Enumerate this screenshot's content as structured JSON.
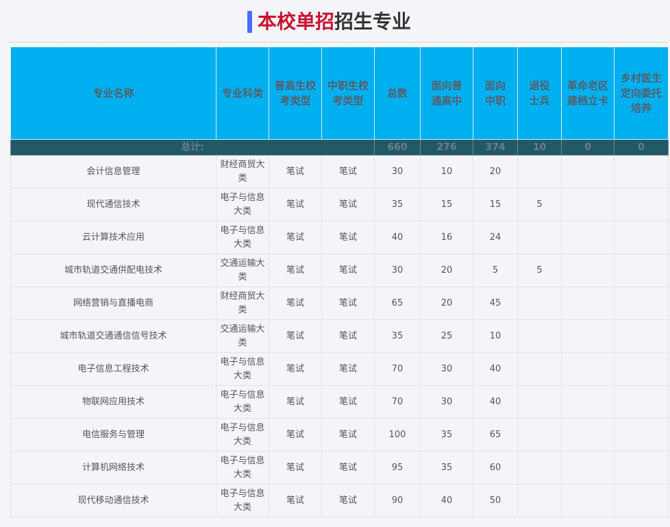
{
  "title": {
    "highlight": "本校单招",
    "rest": "招生专业"
  },
  "columns": [
    "专业名称",
    "专业科类",
    "普高生校考类型",
    "中职生校考类型",
    "总数",
    "面向普通高中",
    "面向中职",
    "退役士兵",
    "革命老区建档立卡",
    "乡村医生定向委托培养"
  ],
  "total": {
    "label": "总计:",
    "values": [
      "660",
      "276",
      "374",
      "10",
      "0",
      "0"
    ]
  },
  "rows": [
    {
      "name": "会计信息管理",
      "category": "财经商贸大类",
      "pugao": "笔试",
      "zhongzhi": "笔试",
      "total": "30",
      "gaozhong": "10",
      "zhongzhi_n": "20",
      "veteran": "",
      "laoqu": "",
      "doctor": ""
    },
    {
      "name": "现代通信技术",
      "category": "电子与信息大类",
      "pugao": "笔试",
      "zhongzhi": "笔试",
      "total": "35",
      "gaozhong": "15",
      "zhongzhi_n": "15",
      "veteran": "5",
      "laoqu": "",
      "doctor": ""
    },
    {
      "name": "云计算技术应用",
      "category": "电子与信息大类",
      "pugao": "笔试",
      "zhongzhi": "笔试",
      "total": "40",
      "gaozhong": "16",
      "zhongzhi_n": "24",
      "veteran": "",
      "laoqu": "",
      "doctor": ""
    },
    {
      "name": "城市轨道交通供配电技术",
      "category": "交通运输大类",
      "pugao": "笔试",
      "zhongzhi": "笔试",
      "total": "30",
      "gaozhong": "20",
      "zhongzhi_n": "5",
      "veteran": "5",
      "laoqu": "",
      "doctor": ""
    },
    {
      "name": "网络营销与直播电商",
      "category": "财经商贸大类",
      "pugao": "笔试",
      "zhongzhi": "笔试",
      "total": "65",
      "gaozhong": "20",
      "zhongzhi_n": "45",
      "veteran": "",
      "laoqu": "",
      "doctor": ""
    },
    {
      "name": "城市轨道交通通信信号技术",
      "category": "交通运输大类",
      "pugao": "笔试",
      "zhongzhi": "笔试",
      "total": "35",
      "gaozhong": "25",
      "zhongzhi_n": "10",
      "veteran": "",
      "laoqu": "",
      "doctor": ""
    },
    {
      "name": "电子信息工程技术",
      "category": "电子与信息大类",
      "pugao": "笔试",
      "zhongzhi": "笔试",
      "total": "70",
      "gaozhong": "30",
      "zhongzhi_n": "40",
      "veteran": "",
      "laoqu": "",
      "doctor": ""
    },
    {
      "name": "物联网应用技术",
      "category": "电子与信息大类",
      "pugao": "笔试",
      "zhongzhi": "笔试",
      "total": "70",
      "gaozhong": "30",
      "zhongzhi_n": "40",
      "veteran": "",
      "laoqu": "",
      "doctor": ""
    },
    {
      "name": "电信服务与管理",
      "category": "电子与信息大类",
      "pugao": "笔试",
      "zhongzhi": "笔试",
      "total": "100",
      "gaozhong": "35",
      "zhongzhi_n": "65",
      "veteran": "",
      "laoqu": "",
      "doctor": ""
    },
    {
      "name": "计算机网络技术",
      "category": "电子与信息大类",
      "pugao": "笔试",
      "zhongzhi": "笔试",
      "total": "95",
      "gaozhong": "35",
      "zhongzhi_n": "60",
      "veteran": "",
      "laoqu": "",
      "doctor": ""
    },
    {
      "name": "现代移动通信技术",
      "category": "电子与信息大类",
      "pugao": "笔试",
      "zhongzhi": "笔试",
      "total": "90",
      "gaozhong": "40",
      "zhongzhi_n": "50",
      "veteran": "",
      "laoqu": "",
      "doctor": ""
    }
  ]
}
